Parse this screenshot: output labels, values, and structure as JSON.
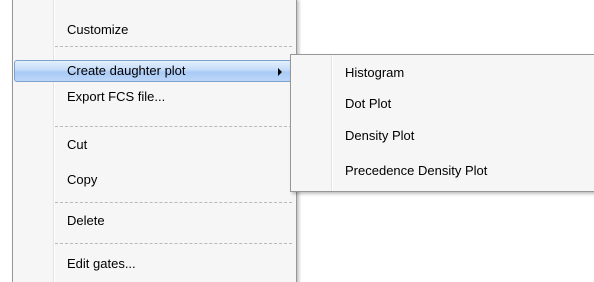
{
  "context_menu": {
    "items": [
      {
        "label": "Customize"
      },
      {
        "label": "Create daughter plot",
        "has_submenu": true,
        "highlighted": true
      },
      {
        "label": "Export FCS file..."
      },
      {
        "label": "Cut"
      },
      {
        "label": "Copy"
      },
      {
        "label": "Delete"
      },
      {
        "label": "Edit gates..."
      }
    ]
  },
  "submenu": {
    "items": [
      {
        "label": "Histogram"
      },
      {
        "label": "Dot Plot"
      },
      {
        "label": "Density Plot"
      },
      {
        "label": "Precedence Density Plot"
      }
    ]
  },
  "colors": {
    "menu_background": "#f6f6f6",
    "menu_border": "#979797",
    "highlight_border": "#7da2ce",
    "highlight_fill": "#bcd6f8"
  },
  "icons": {
    "submenu_arrow": "chevron-right-icon"
  }
}
